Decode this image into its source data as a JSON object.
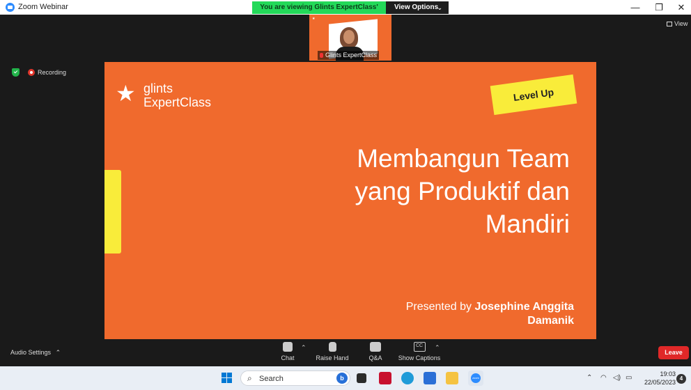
{
  "window": {
    "title": "Zoom Webinar",
    "share_banner": "You are viewing Glints ExpertClass' screen",
    "view_options": "View Options",
    "controls": {
      "minimize": "—",
      "restore": "❐",
      "close": "✕"
    }
  },
  "stage": {
    "thumbnail_name": "Glints ExpertClass",
    "view_label": "View",
    "recording_label": "Recording"
  },
  "slide": {
    "logo_line1": "glints",
    "logo_line2": "ExpertClass",
    "badge": "Level Up",
    "headline_line1": "Membangun Team",
    "headline_line2": "yang Produktif dan",
    "headline_line3": "Mandiri",
    "presented_prefix": "Presented by",
    "presenter_line1": "Josephine Anggita",
    "presenter_line2": "Damanik",
    "colors": {
      "background": "#f06a2d",
      "accent": "#f9ec3a"
    }
  },
  "toolbar": {
    "audio_settings": "Audio Settings",
    "chat": "Chat",
    "raise_hand": "Raise Hand",
    "qa": "Q&A",
    "cc": "CC",
    "show_captions": "Show Captions",
    "leave": "Leave"
  },
  "taskbar": {
    "search_placeholder": "Search",
    "bing_label": "b",
    "time": "19:03",
    "date": "22/05/2023",
    "notifications": "4",
    "zoom_app_label": "zoom"
  }
}
